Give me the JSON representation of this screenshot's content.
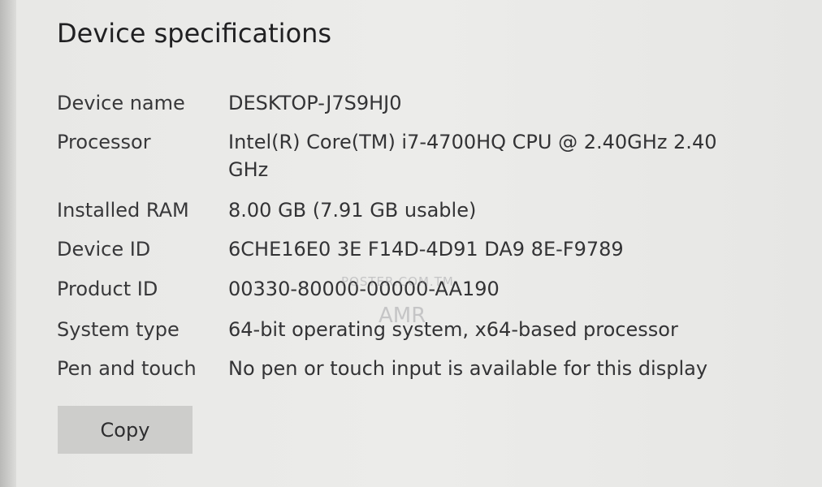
{
  "section_title": "Device specifications",
  "specs": [
    {
      "label": "Device name",
      "value": "DESKTOP-J7S9HJ0"
    },
    {
      "label": "Processor",
      "value": "Intel(R) Core(TM) i7-4700HQ CPU @ 2.40GHz   2.40 GHz"
    },
    {
      "label": "Installed RAM",
      "value": "8.00 GB (7.91 GB usable)"
    },
    {
      "label": "Device ID",
      "value": "6CHE16E0 3E F14D-4D91 DA9 8E-F9789"
    },
    {
      "label": "Product ID",
      "value": "00330-80000-00000-AA190"
    },
    {
      "label": "System type",
      "value": "64-bit operating system, x64-based processor"
    },
    {
      "label": "Pen and touch",
      "value": "No pen or touch input is available for this display"
    }
  ],
  "copy_button_label": "Copy",
  "watermark": {
    "site": "POSTER.COM.TM",
    "brand": "AMR"
  }
}
